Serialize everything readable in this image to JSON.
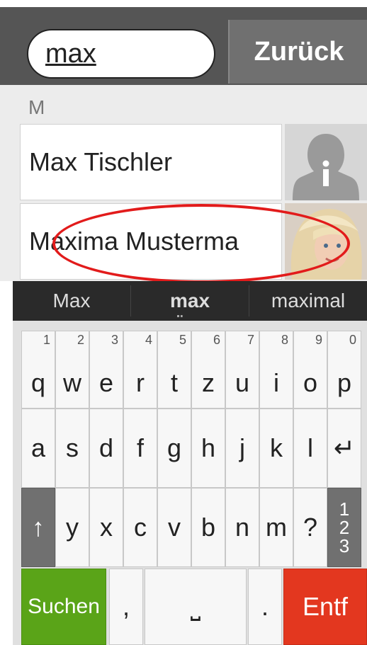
{
  "search": {
    "value": "max"
  },
  "back_button": {
    "label": "Zurück"
  },
  "contacts": {
    "section_letter": "M",
    "items": [
      {
        "name": "Max Tischler",
        "avatar": "placeholder-person-icon"
      },
      {
        "name": "Maxima Musterma",
        "avatar": "photo-avatar"
      }
    ]
  },
  "suggestions": [
    "Max",
    "max",
    "maximal"
  ],
  "keyboard": {
    "row1": [
      {
        "num": "1",
        "ch": "q"
      },
      {
        "num": "2",
        "ch": "w"
      },
      {
        "num": "3",
        "ch": "e"
      },
      {
        "num": "4",
        "ch": "r"
      },
      {
        "num": "5",
        "ch": "t"
      },
      {
        "num": "6",
        "ch": "z"
      },
      {
        "num": "7",
        "ch": "u"
      },
      {
        "num": "8",
        "ch": "i"
      },
      {
        "num": "9",
        "ch": "o"
      },
      {
        "num": "0",
        "ch": "p"
      }
    ],
    "row2": [
      "a",
      "s",
      "d",
      "f",
      "g",
      "h",
      "j",
      "k",
      "l",
      "↵"
    ],
    "row3": [
      "↑",
      "y",
      "x",
      "c",
      "v",
      "b",
      "n",
      "m",
      "?",
      "1 2 3"
    ],
    "row4": {
      "search_label": "Suchen",
      "comma": ",",
      "space": "⎵",
      "period": ".",
      "delete_label": "Entf"
    }
  },
  "colors": {
    "topbar": "#555555",
    "search_key": "#5aa418",
    "delete_key": "#e3371f",
    "highlight_ellipse": "#e21b1b"
  }
}
